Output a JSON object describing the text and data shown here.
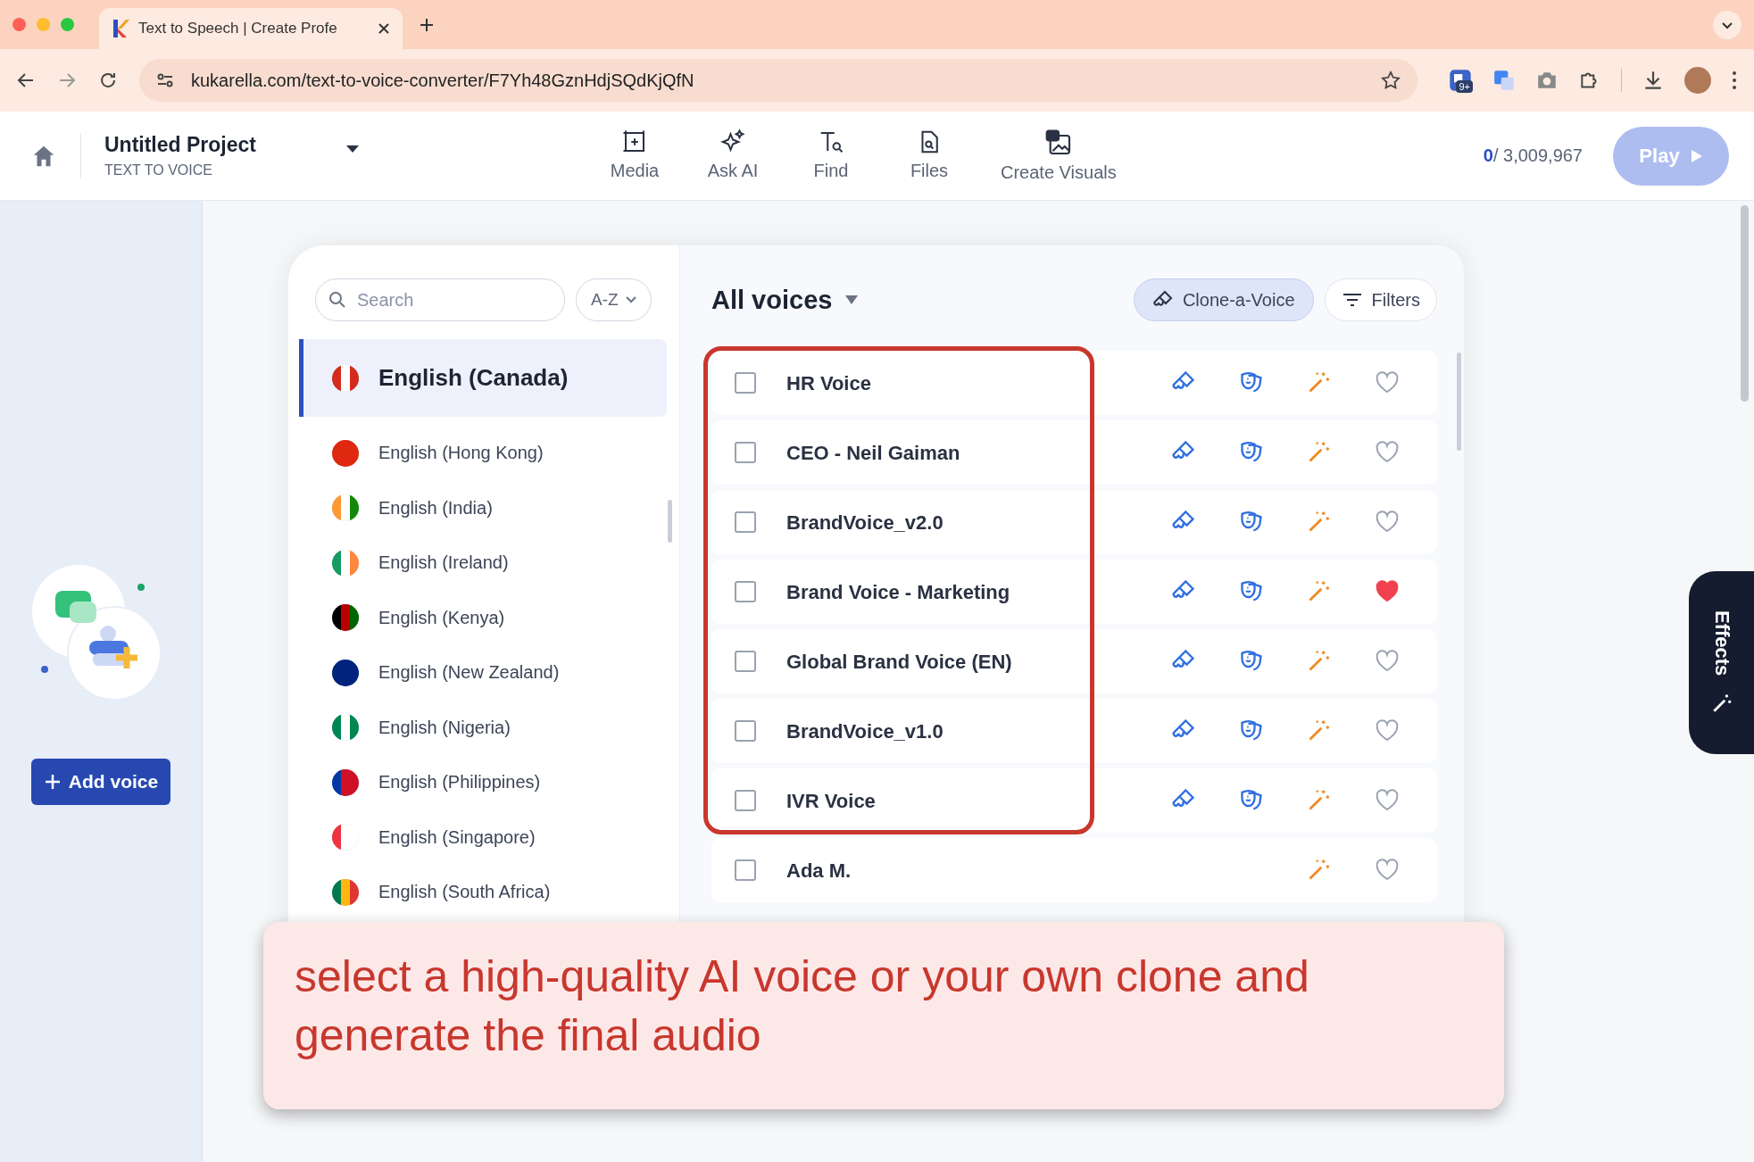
{
  "browser": {
    "tabs": [
      {
        "title": "Text to Speech | Create Profe",
        "selected": true
      }
    ],
    "url": "kukarella.com/text-to-voice-converter/F7Yh48GznHdjSQdKjQfN",
    "extension_badge": "9+"
  },
  "header": {
    "project_title": "Untitled Project",
    "subtitle": "TEXT TO VOICE",
    "tools": [
      {
        "label": "Media",
        "kind": "media"
      },
      {
        "label": "Ask AI",
        "kind": "ai"
      },
      {
        "label": "Find",
        "kind": "find"
      },
      {
        "label": "Files",
        "kind": "files"
      },
      {
        "label": "Create Visuals",
        "kind": "visuals"
      }
    ],
    "count_used": "0",
    "count_total": "/ 3,009,967",
    "play": "Play"
  },
  "sidebar": {
    "add_voice": "Add voice"
  },
  "languages": {
    "search": {
      "placeholder": "Search"
    },
    "sort": "A-Z",
    "items": [
      {
        "name": "English (Canada)",
        "selected": true
      },
      {
        "name": "English (Hong Kong)",
        "selected": false
      },
      {
        "name": "English (India)",
        "selected": false
      },
      {
        "name": "English (Ireland)",
        "selected": false
      },
      {
        "name": "English (Kenya)",
        "selected": false
      },
      {
        "name": "English (New Zealand)",
        "selected": false
      },
      {
        "name": "English (Nigeria)",
        "selected": false
      },
      {
        "name": "English (Philippines)",
        "selected": false
      },
      {
        "name": "English (Singapore)",
        "selected": false
      },
      {
        "name": "English (South Africa)",
        "selected": false
      }
    ]
  },
  "voices": {
    "title": "All voices",
    "clone_button": "Clone-a-Voice",
    "filters_button": "Filters",
    "rows": [
      {
        "name": "HR Voice",
        "kind": "clone",
        "checked": false,
        "favorite": false
      },
      {
        "name": "CEO - Neil Gaiman",
        "kind": "clone",
        "checked": false,
        "favorite": false
      },
      {
        "name": "BrandVoice_v2.0",
        "kind": "clone",
        "checked": false,
        "favorite": false
      },
      {
        "name": "Brand Voice - Marketing",
        "kind": "clone",
        "checked": false,
        "favorite": true
      },
      {
        "name": "Global Brand Voice (EN)",
        "kind": "clone",
        "checked": false,
        "favorite": false
      },
      {
        "name": "BrandVoice_v1.0",
        "kind": "clone",
        "checked": false,
        "favorite": false
      },
      {
        "name": "IVR Voice",
        "kind": "clone",
        "checked": false,
        "favorite": false
      },
      {
        "name": "Ada M.",
        "kind": "stock",
        "checked": false,
        "favorite": false
      }
    ]
  },
  "effects_tab": "Effects",
  "callout": "select a high-quality AI voice or your own clone and generate the final audio"
}
